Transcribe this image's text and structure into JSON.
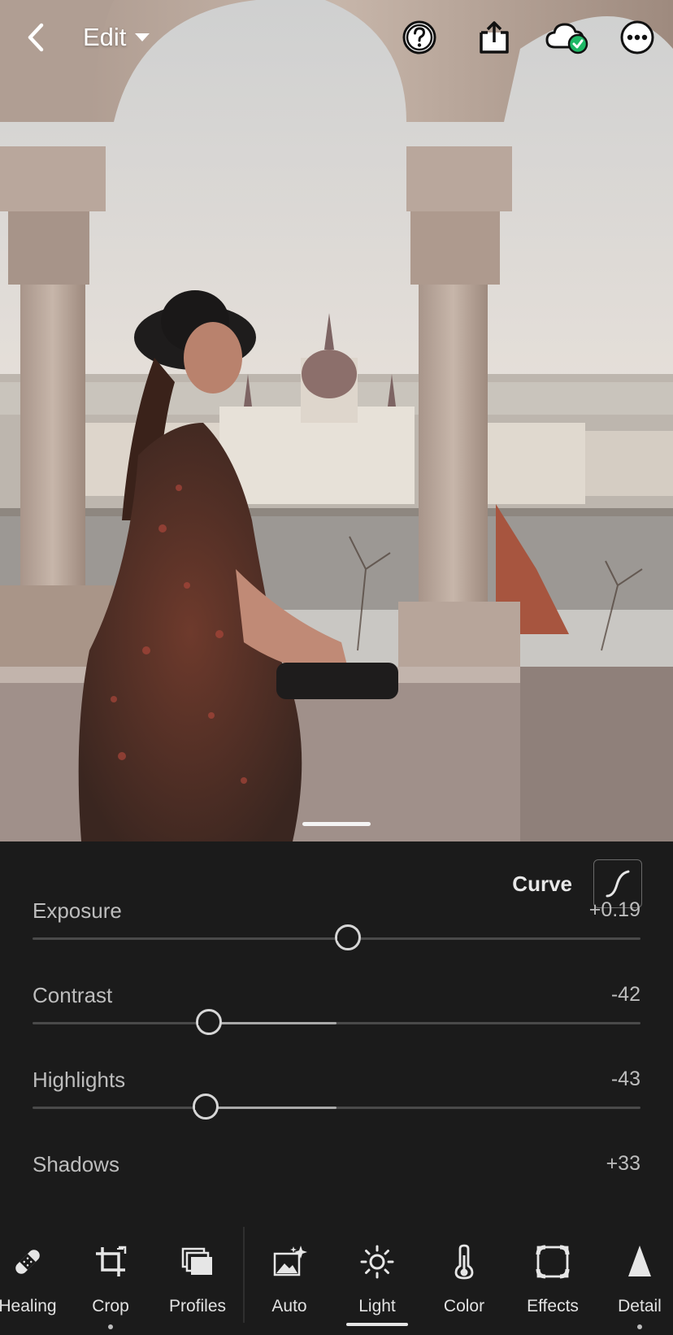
{
  "topbar": {
    "back_icon": "chevron-left-icon",
    "title": "Edit",
    "help_icon": "help-icon",
    "share_icon": "share-icon",
    "cloud_icon": "cloud-synced-icon",
    "more_icon": "more-icon"
  },
  "photo": {
    "description_icon": "photo"
  },
  "panel": {
    "curve_label": "Curve",
    "sliders": [
      {
        "name": "Exposure",
        "value": "+0.19",
        "level": 0.519
      },
      {
        "name": "Contrast",
        "value": "-42",
        "level": 0.29
      },
      {
        "name": "Highlights",
        "value": "-43",
        "level": 0.285
      },
      {
        "name": "Shadows",
        "value": "+33"
      }
    ]
  },
  "toolbar": {
    "tools": [
      {
        "label": "Healing",
        "icon": "bandage-icon"
      },
      {
        "label": "Crop",
        "icon": "crop-icon"
      },
      {
        "label": "Profiles",
        "icon": "profiles-icon"
      },
      {
        "label": "Auto",
        "icon": "auto-icon"
      },
      {
        "label": "Light",
        "icon": "sun-icon",
        "active": true
      },
      {
        "label": "Color",
        "icon": "thermometer-icon"
      },
      {
        "label": "Effects",
        "icon": "effects-icon"
      },
      {
        "label": "Detail",
        "icon": "detail-icon"
      }
    ]
  },
  "colors": {
    "background": "#1b1b1b",
    "accent_check": "#1fb866"
  }
}
